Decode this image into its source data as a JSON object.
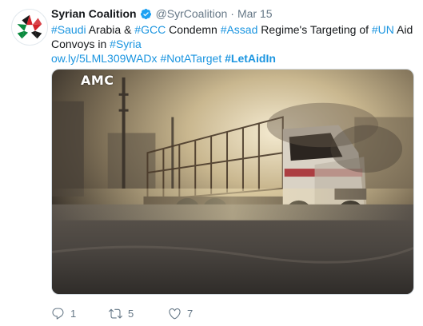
{
  "tweet": {
    "display_name": "Syrian Coalition",
    "handle": "@SyrCoalition",
    "separator": "·",
    "date": "Mar 15",
    "line1": [
      {
        "text": "#Saudi",
        "style": "hl"
      },
      {
        "text": " Arabia & ",
        "style": ""
      },
      {
        "text": "#GCC",
        "style": "hl"
      },
      {
        "text": " Condemn ",
        "style": ""
      },
      {
        "text": "#Assad",
        "style": "hl"
      },
      {
        "text": " Regime's Targeting of ",
        "style": ""
      },
      {
        "text": "#UN",
        "style": "hl"
      },
      {
        "text": " Aid",
        "style": ""
      }
    ],
    "line2": [
      {
        "text": "Convoys in ",
        "style": ""
      },
      {
        "text": "#Syria",
        "style": "hl"
      }
    ],
    "line3": [
      {
        "text": "ow.ly/5LML309WADx",
        "style": "hl"
      },
      {
        "text": " ",
        "style": ""
      },
      {
        "text": "#NotATarget",
        "style": "hl"
      },
      {
        "text": " ",
        "style": ""
      },
      {
        "text": "#LetAidIn",
        "style": "hl bold"
      }
    ],
    "media_watermark": "AMC",
    "replies": "1",
    "retweets": "5",
    "likes": "7"
  },
  "icons": {
    "avatar": "syrian-coalition-star-logo",
    "verified": "verified-badge-icon",
    "reply": "reply-icon",
    "retweet": "retweet-icon",
    "like": "heart-icon"
  },
  "colors": {
    "link": "#1b95e0",
    "muted": "#657786",
    "text": "#14171a",
    "logo_red": "#d2232a",
    "logo_green": "#0a8a3e"
  }
}
